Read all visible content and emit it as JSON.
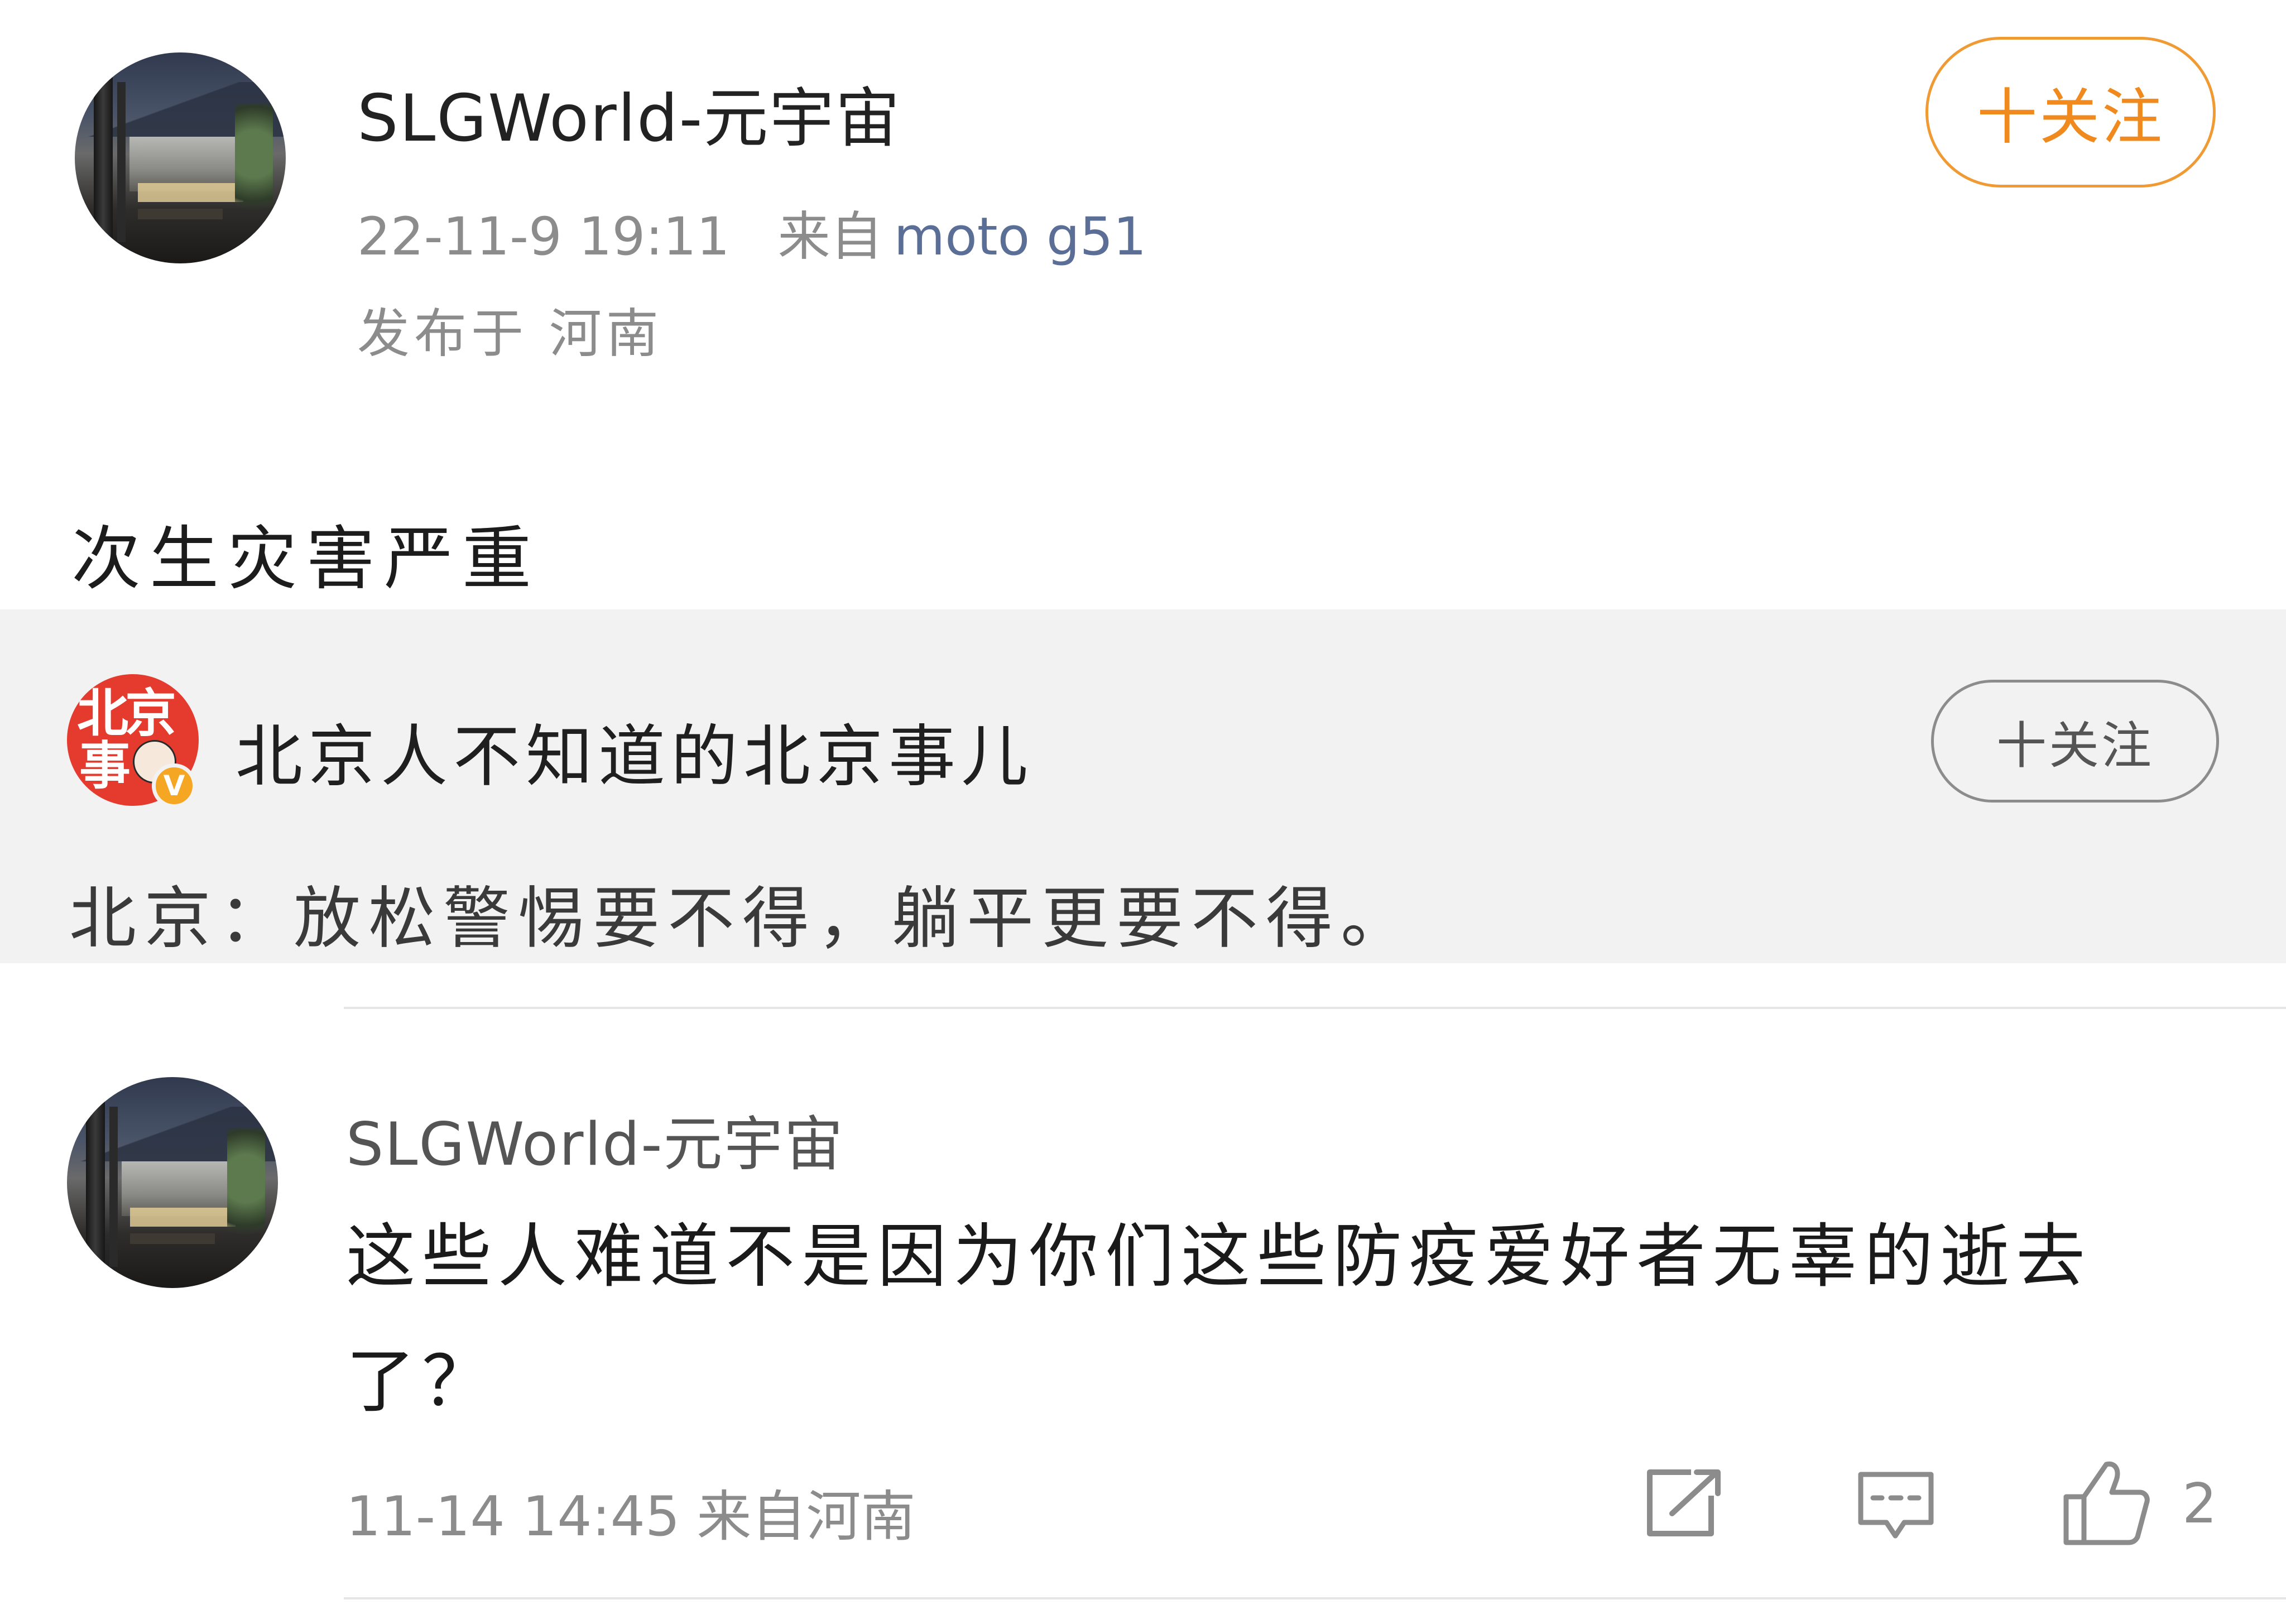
{
  "post": {
    "author": "SLGWorld-元宇宙",
    "timestamp": "22-11-9 19:11",
    "source_prefix": "来自",
    "source_device": "moto g51",
    "location": "发布于 河南",
    "follow_label": "十关注",
    "text": "次生灾害严重"
  },
  "quoted": {
    "author": "北京人不知道的北京事儿",
    "avatar_text_1": "北京",
    "avatar_text_2": "事",
    "verified_badge": "V",
    "follow_label": "十关注",
    "text": "北京：放松警惕要不得，躺平更要不得。"
  },
  "comment": {
    "author": "SLGWorld-元宇宙",
    "text": "这些人难道不是因为你们这些防疫爱好者无辜的逝去了？",
    "timestamp": "11-14 14:45",
    "source": "来自河南",
    "like_count": "2",
    "actions": [
      "share-icon",
      "comment-icon",
      "like-icon"
    ]
  },
  "colors": {
    "follow_accent": "#f08a1e",
    "source_link": "#5b6e96",
    "quote_background": "#f2f2f2",
    "verified_badge": "#f5a623",
    "brand_avatar": "#e53a2e"
  }
}
